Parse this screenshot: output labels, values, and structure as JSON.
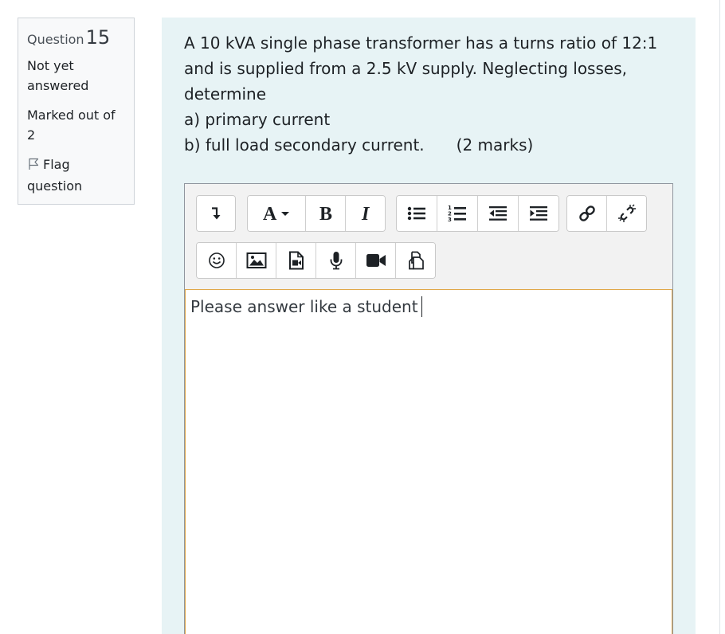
{
  "info": {
    "question_label": "Question",
    "question_number": "15",
    "state": "Not yet answered",
    "grade": "Marked out of 2",
    "flag_label": "Flag question",
    "flag_icon": "flag-icon"
  },
  "question": {
    "lines": [
      "A 10 kVA single phase transformer has a turns ratio of 12:1",
      "and is supplied from a 2.5 kV supply. Neglecting losses,",
      "determine",
      "a) primary current",
      "b) full load secondary current."
    ],
    "marks": "(2 marks)"
  },
  "editor": {
    "answer_text": "Please answer like a student",
    "toolbar": {
      "row1": [
        [
          "toggle-toolbar-icon"
        ],
        [
          "font-color-icon",
          "bold-icon",
          "italic-icon"
        ],
        [
          "bullet-list-icon",
          "numbered-list-icon",
          "outdent-icon",
          "indent-icon"
        ],
        [
          "link-icon",
          "unlink-icon"
        ]
      ],
      "row2": [
        [
          "emoji-icon",
          "image-icon",
          "media-icon",
          "record-audio-icon",
          "record-video-icon",
          "manage-files-icon"
        ]
      ]
    },
    "accent_color": "#e0a84a"
  },
  "colors": {
    "content_background": "#e7f3f5",
    "info_background": "#f8f9fa",
    "toolbar_background": "#f2f2f2"
  }
}
